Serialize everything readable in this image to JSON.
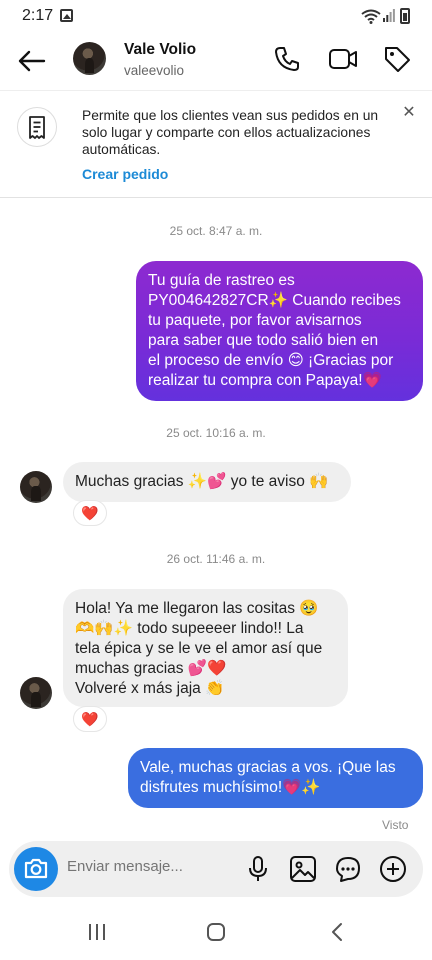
{
  "status_bar": {
    "time": "2:17",
    "icons": [
      "gallery-icon",
      "wifi-icon",
      "signal-icon",
      "battery-icon"
    ]
  },
  "header": {
    "contact_name": "Vale Volio",
    "username": "valeevolio",
    "icons": [
      "back-arrow-icon",
      "phone-icon",
      "video-camera-icon",
      "tag-icon"
    ]
  },
  "banner": {
    "text": "Permite que los clientes vean sus pedidos en un solo lugar y comparte con ellos actualizaciones automáticas.",
    "link": "Crear pedido",
    "icon": "receipt-icon",
    "close_icon": "close-icon"
  },
  "messages": [
    {
      "timestamp": "25 oct. 8:47 a. m.",
      "direction": "outgoing",
      "lines": [
        "Tu guía de rastreo es",
        "PY004642827CR✨ Cuando recibes",
        "tu paquete, por favor avisarnos",
        "para saber que todo salió bien en",
        "el proceso de envío 😊 ¡Gracias por",
        "realizar tu compra con Papaya!💗"
      ]
    },
    {
      "timestamp": "25 oct. 10:16 a. m.",
      "direction": "incoming",
      "lines": [
        "Muchas gracias ✨💕 yo te aviso 🙌"
      ],
      "reaction": "❤️"
    },
    {
      "timestamp": "26 oct. 11:46 a. m.",
      "direction": "incoming",
      "lines": [
        "Hola! Ya me llegaron las cositas 🥹",
        "🫶🙌✨ todo supeeeer lindo!! La",
        "tela épica y se le ve el amor así que",
        "muchas gracias 💕❤️",
        "Volveré x más jaja 👏"
      ],
      "reaction": "❤️"
    },
    {
      "direction": "outgoing",
      "lines": [
        "Vale, muchas gracias a vos. ¡Que las",
        "disfrutes muchísimo!💗✨"
      ]
    }
  ],
  "seen_label": "Visto",
  "composer": {
    "placeholder": "Enviar mensaje...",
    "icons": [
      "camera-icon",
      "microphone-icon",
      "image-icon",
      "sticker-icon",
      "plus-icon"
    ]
  },
  "nav_bar": {
    "icons": [
      "recent-apps-icon",
      "home-icon",
      "back-icon"
    ]
  },
  "colors": {
    "outgoing_purple": "#7a2bd6",
    "outgoing_blue": "#3a6ee0",
    "incoming_gray": "#efefef",
    "link_blue": "#1c8ad6"
  }
}
